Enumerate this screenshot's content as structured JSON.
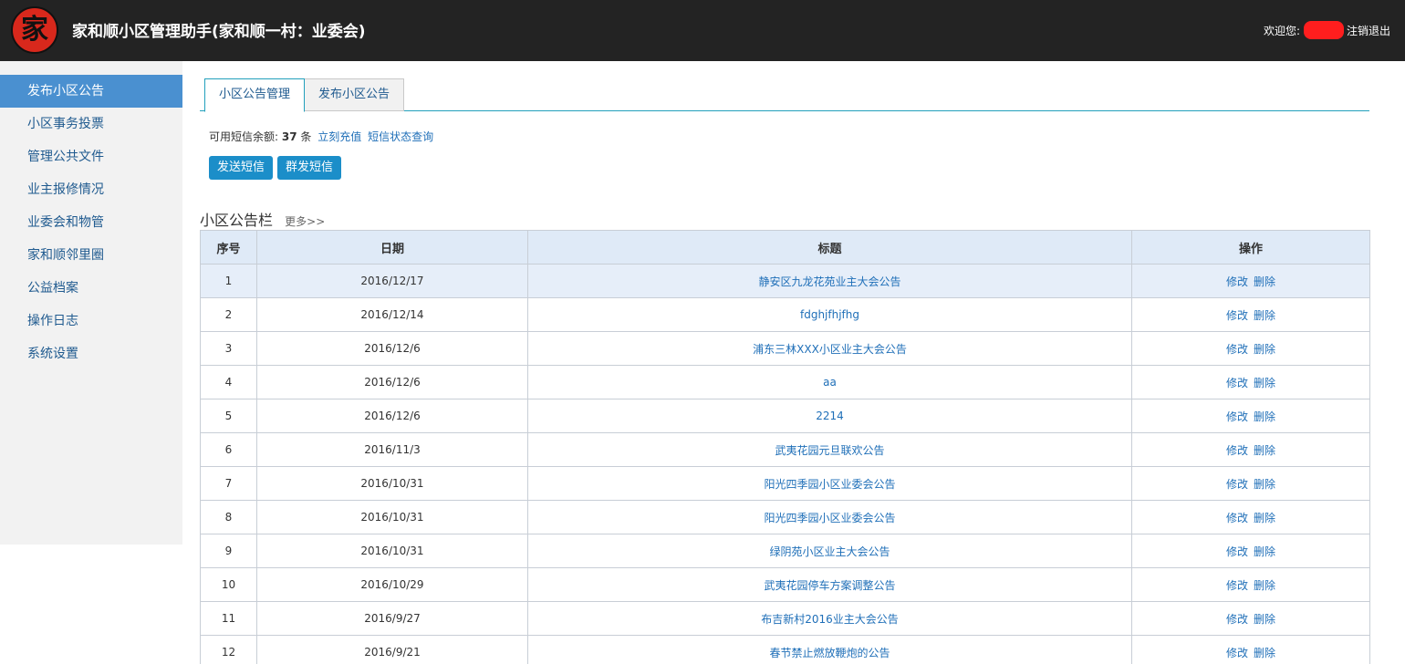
{
  "header": {
    "logo_char": "家",
    "title": "家和顺小区管理助手(家和顺一村：业委会)",
    "welcome": "欢迎您:",
    "logout": "注销退出"
  },
  "sidebar": {
    "items": [
      {
        "label": "发布小区公告",
        "active": true
      },
      {
        "label": "小区事务投票"
      },
      {
        "label": "管理公共文件"
      },
      {
        "label": "业主报修情况"
      },
      {
        "label": "业委会和物管"
      },
      {
        "label": "家和顺邻里圈"
      },
      {
        "label": "公益档案"
      },
      {
        "label": "操作日志"
      },
      {
        "label": "系统设置"
      }
    ]
  },
  "tabs": [
    {
      "label": "小区公告管理",
      "active": true
    },
    {
      "label": "发布小区公告"
    }
  ],
  "sms": {
    "prefix": "可用短信余额:",
    "count": "37",
    "unit": "条",
    "recharge": "立刻充值",
    "status_query": "短信状态查询"
  },
  "buttons": {
    "send_sms": "发送短信",
    "group_sms": "群发短信"
  },
  "board": {
    "title": "小区公告栏",
    "more": "更多>>"
  },
  "table": {
    "headers": [
      "序号",
      "日期",
      "标题",
      "操作"
    ],
    "edit_label": "修改",
    "delete_label": "删除",
    "rows": [
      {
        "no": "1",
        "date": "2016/12/17",
        "title": "静安区九龙花苑业主大会公告"
      },
      {
        "no": "2",
        "date": "2016/12/14",
        "title": "fdghjfhjfhg"
      },
      {
        "no": "3",
        "date": "2016/12/6",
        "title": "浦东三林XXX小区业主大会公告"
      },
      {
        "no": "4",
        "date": "2016/12/6",
        "title": "aa"
      },
      {
        "no": "5",
        "date": "2016/12/6",
        "title": "2214"
      },
      {
        "no": "6",
        "date": "2016/11/3",
        "title": "武夷花园元旦联欢公告"
      },
      {
        "no": "7",
        "date": "2016/10/31",
        "title": "阳光四季园小区业委会公告"
      },
      {
        "no": "8",
        "date": "2016/10/31",
        "title": "阳光四季园小区业委会公告"
      },
      {
        "no": "9",
        "date": "2016/10/31",
        "title": "绿阴苑小区业主大会公告"
      },
      {
        "no": "10",
        "date": "2016/10/29",
        "title": "武夷花园停车方案调整公告"
      },
      {
        "no": "11",
        "date": "2016/9/27",
        "title": "布吉新村2016业主大会公告"
      },
      {
        "no": "12",
        "date": "2016/9/21",
        "title": "春节禁止燃放鞭炮的公告"
      }
    ]
  }
}
